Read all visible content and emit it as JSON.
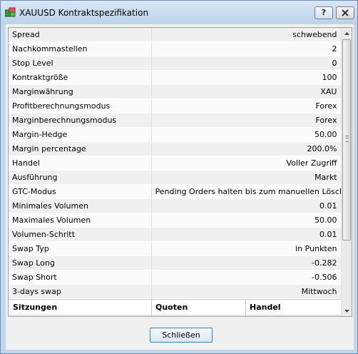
{
  "window": {
    "title": "XAUUSD Kontraktspezifikation",
    "help_label": "?",
    "close_label": "X"
  },
  "spec_rows": [
    {
      "label": "Spread",
      "value": "schwebend"
    },
    {
      "label": "Nachkommastellen",
      "value": "2"
    },
    {
      "label": "Stop Level",
      "value": "0"
    },
    {
      "label": "Kontraktgröße",
      "value": "100"
    },
    {
      "label": "Marginwährung",
      "value": "XAU"
    },
    {
      "label": "Profitberechnungsmodus",
      "value": "Forex"
    },
    {
      "label": "Marginberechnungsmodus",
      "value": "Forex"
    },
    {
      "label": "Margin-Hedge",
      "value": "50.00"
    },
    {
      "label": "Margin percentage",
      "value": "200.0%"
    },
    {
      "label": "Handel",
      "value": "Voller Zugriff"
    },
    {
      "label": "Ausführung",
      "value": "Markt"
    },
    {
      "label": "GTC-Modus",
      "value": "Pending Orders halten bis zum manuellen Löschen"
    },
    {
      "label": "Minimales Volumen",
      "value": "0.01"
    },
    {
      "label": "Maximales Volumen",
      "value": "50.00"
    },
    {
      "label": "Volumen-Schritt",
      "value": "0.01"
    },
    {
      "label": "Swap Typ",
      "value": "in Punkten"
    },
    {
      "label": "Swap Long",
      "value": "-0.282"
    },
    {
      "label": "Swap Short",
      "value": "-0.506"
    },
    {
      "label": "3-days swap",
      "value": "Mittwoch"
    }
  ],
  "sessions": {
    "col_sitzungen": "Sitzungen",
    "col_quoten": "Quoten",
    "col_handel": "Handel"
  },
  "footer": {
    "close_button_label": "Schließen"
  },
  "icons": {
    "app": "green-boxes-icon",
    "scroll_up": "arrow-up-icon",
    "scroll_down": "arrow-down-icon"
  }
}
